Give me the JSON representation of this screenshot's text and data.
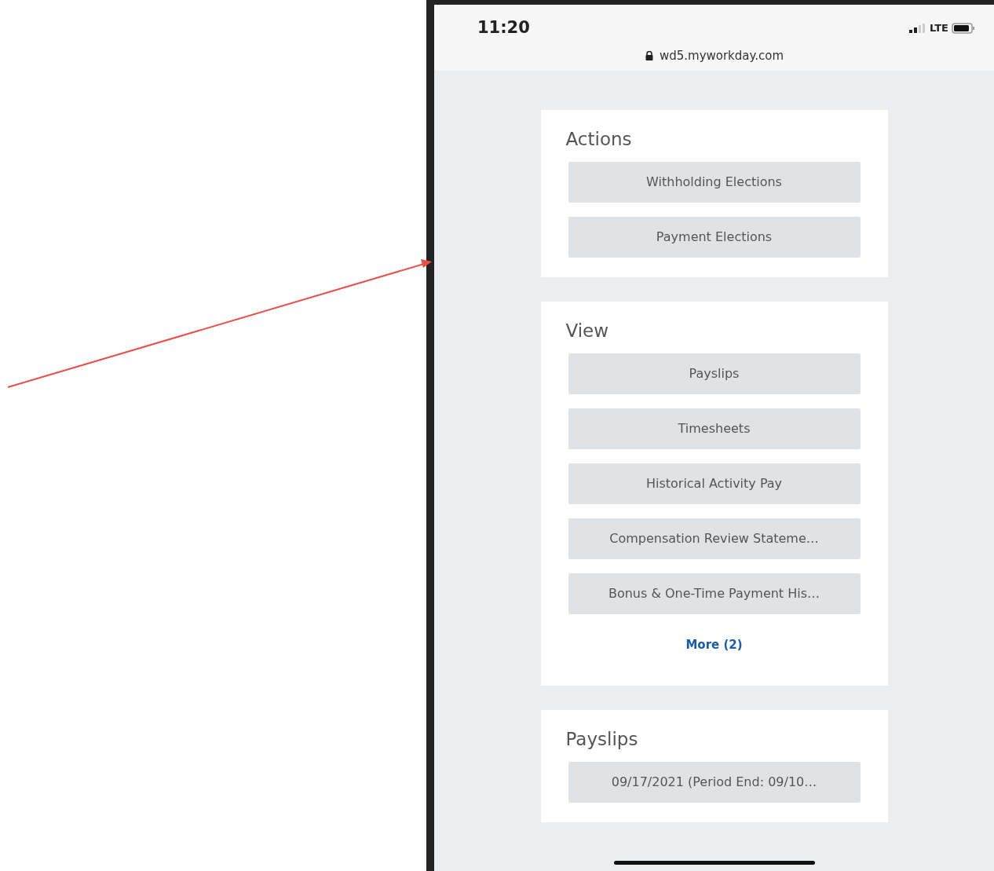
{
  "status_bar": {
    "time": "11:20",
    "network": "LTE"
  },
  "address_bar": {
    "url": "wd5.myworkday.com"
  },
  "sections": [
    {
      "title": "Actions",
      "buttons": [
        "Withholding Elections",
        "Payment Elections"
      ]
    },
    {
      "title": "View",
      "buttons": [
        "Payslips",
        "Timesheets",
        "Historical Activity Pay",
        "Compensation Review Stateme…",
        "Bonus & One-Time Payment His…"
      ],
      "more_link": "More (2)"
    },
    {
      "title": "Payslips",
      "buttons": [
        "09/17/2021 (Period End: 09/10…"
      ]
    }
  ]
}
